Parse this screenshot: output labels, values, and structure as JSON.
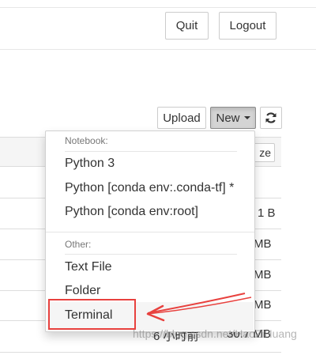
{
  "header": {
    "quit_label": "Quit",
    "logout_label": "Logout"
  },
  "toolbar": {
    "upload_label": "Upload",
    "new_label": "New",
    "refresh_icon": "refresh-icon"
  },
  "file_list": {
    "sort_label_partial": "ze",
    "rows": [
      {
        "size": "1 B",
        "date": ""
      },
      {
        "size": "MB",
        "date": ""
      },
      {
        "size": "MB",
        "date": ""
      },
      {
        "size": "MB",
        "date": ""
      },
      {
        "size": "30.7 MB",
        "date": "6 小时前"
      }
    ]
  },
  "new_menu": {
    "notebook_header": "Notebook:",
    "notebook_items": [
      "Python 3",
      "Python [conda env:.conda-tf] *",
      "Python [conda env:root]"
    ],
    "other_header": "Other:",
    "other_items": [
      "Text File",
      "Folder",
      "Terminal"
    ]
  },
  "annotation": {
    "color": "#e8413e"
  },
  "watermark": "https://blog.csdn.net/HaoZiHuang"
}
